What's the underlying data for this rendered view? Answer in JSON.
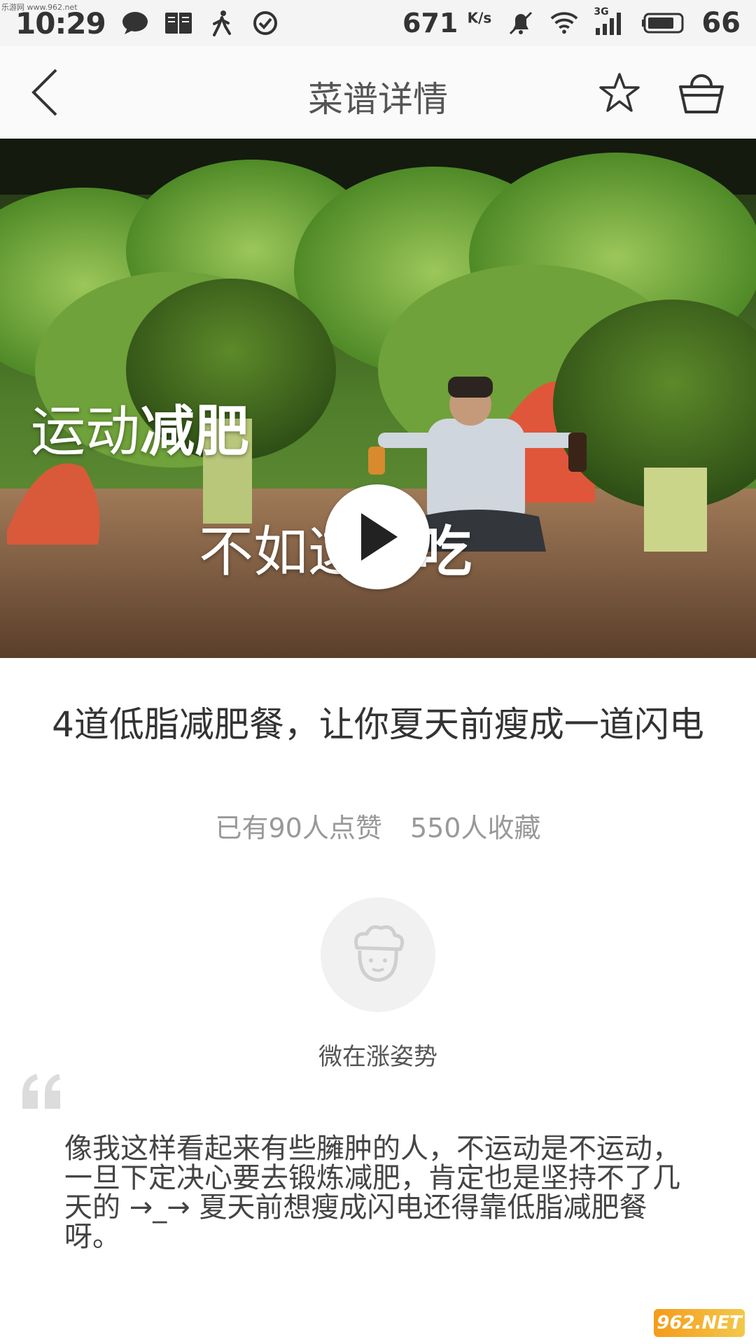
{
  "status_bar": {
    "time": "10:29",
    "speed": "671",
    "speed_unit": "K/s",
    "network": "3G",
    "battery": "66",
    "watermark": "乐游网 www.962.net"
  },
  "header": {
    "title": "菜谱详情",
    "icons": [
      "back-arrow-icon",
      "star-icon",
      "basket-icon"
    ]
  },
  "video": {
    "overlay_line1_light": "运动",
    "overlay_line1_bold": "减肥",
    "overlay_line2_light": "不如这样",
    "overlay_line2_bold": "吃"
  },
  "recipe": {
    "title": "4道低脂减肥餐，让你夏天前瘦成一道闪电",
    "likes": "已有90人点赞",
    "favorites": "550人收藏"
  },
  "author": {
    "name": "微在涨姿势"
  },
  "description": "像我这样看起来有些臃肿的人，不运动是不运动，一旦下定决心要去锻炼减肥，肯定也是坚持不了几天的 →_→ 夏天前想瘦成闪电还得靠低脂减肥餐呀。",
  "watermark_bottom": "962.NET"
}
